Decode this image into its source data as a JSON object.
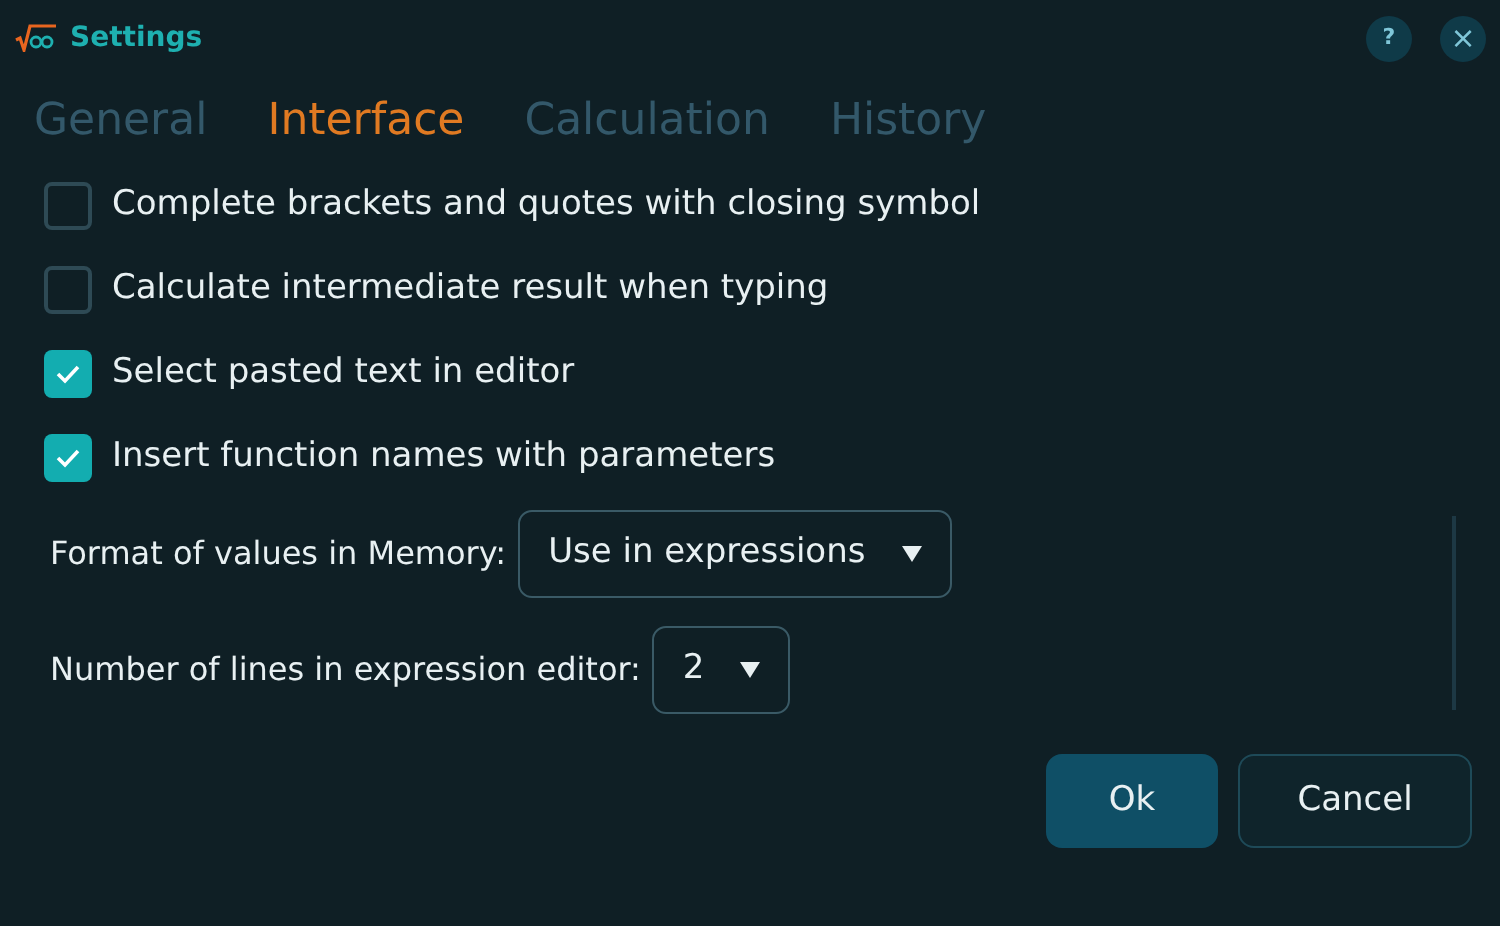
{
  "window": {
    "title": "Settings",
    "help": "?",
    "close": "×"
  },
  "tabs": [
    {
      "label": "General",
      "selected": false
    },
    {
      "label": "Interface",
      "selected": true
    },
    {
      "label": "Calculation",
      "selected": false
    },
    {
      "label": "History",
      "selected": false
    }
  ],
  "options": [
    {
      "label": "Complete brackets and quotes with closing symbol",
      "checked": false
    },
    {
      "label": "Calculate intermediate result when typing",
      "checked": false
    },
    {
      "label": "Select pasted text in editor",
      "checked": true
    },
    {
      "label": "Insert function names with parameters",
      "checked": true
    }
  ],
  "dropdowns": [
    {
      "label": "Format of values in Memory:",
      "value": "Use in expressions"
    },
    {
      "label": "Number of lines in expression editor:",
      "value": "2"
    }
  ],
  "buttons": [
    {
      "label": "Ok",
      "kind": "primary"
    },
    {
      "label": "Cancel",
      "kind": "secondary"
    }
  ]
}
